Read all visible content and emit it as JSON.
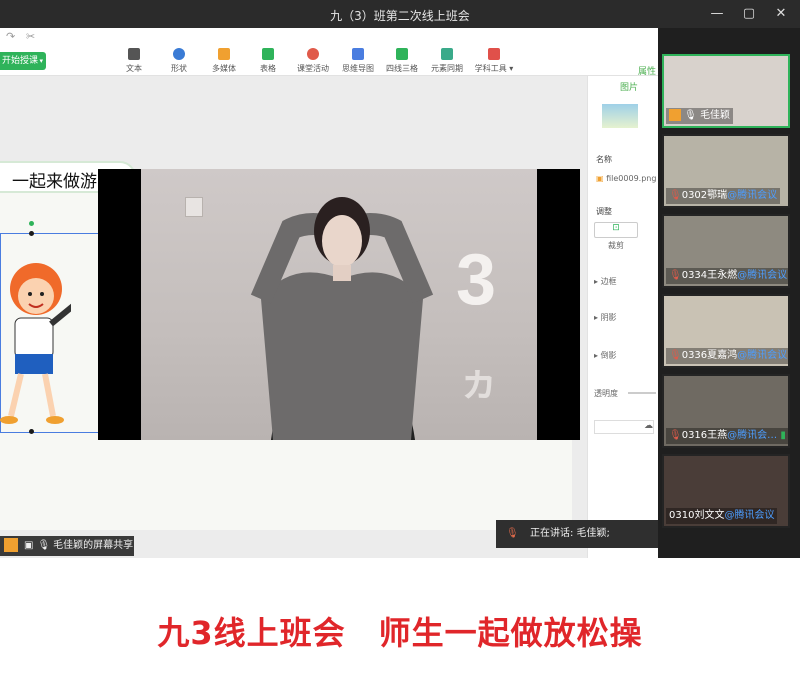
{
  "window": {
    "title": "九（3）班第二次线上班会"
  },
  "toolbar": {
    "start_label": "开始授课",
    "tools": [
      {
        "label": "文本",
        "color": "#555555"
      },
      {
        "label": "形状",
        "color": "#3a7bd5"
      },
      {
        "label": "多媒体",
        "color": "#f0a030"
      },
      {
        "label": "表格",
        "color": "#2fb35a"
      },
      {
        "label": "课堂活动",
        "color": "#e05a4a"
      },
      {
        "label": "思维导图",
        "color": "#4a7de0"
      },
      {
        "label": "四线三格",
        "color": "#2fb35a"
      },
      {
        "label": "元素同期",
        "color": "#3aaa8a"
      },
      {
        "label": "学科工具 ▾",
        "color": "#e0504a"
      }
    ]
  },
  "slide": {
    "title": "一起来做游"
  },
  "video": {
    "overlay_number_1": "3",
    "overlay_number_2": "ヵ"
  },
  "properties_panel": {
    "tab": "图片",
    "top_tab": "属性",
    "name_label": "名称",
    "file_name": "file0009.png",
    "adjust_label": "调整",
    "crop_label": "裁剪",
    "border_label": "边框",
    "shadow_label": "阴影",
    "reflection_label": "倒影",
    "opacity_label": "透明度"
  },
  "status": {
    "screen_share": "毛佳颖的屏幕共享",
    "speaking": "正在讲话: 毛佳颖;"
  },
  "participants": [
    {
      "name": "毛佳颖",
      "tag": "",
      "active": true,
      "bg": "#d8d2cc"
    },
    {
      "name": "0302鄂瑞",
      "tag": "@腾讯会议",
      "active": false,
      "bg": "#b7b3a6"
    },
    {
      "name": "0334王永燃",
      "tag": "@腾讯会议",
      "active": false,
      "bg": "#8e8a80"
    },
    {
      "name": "0336夏嘉鸿",
      "tag": "@腾讯会议",
      "active": false,
      "bg": "#c9c2b4"
    },
    {
      "name": "0316王燕",
      "tag": "@腾讯会…",
      "active": false,
      "bg": "#6f6a62"
    },
    {
      "name": "0310刘文文",
      "tag": "@腾讯会议",
      "active": false,
      "bg": "#4a3d38"
    }
  ],
  "caption": "九3线上班会　师生一起做放松操"
}
